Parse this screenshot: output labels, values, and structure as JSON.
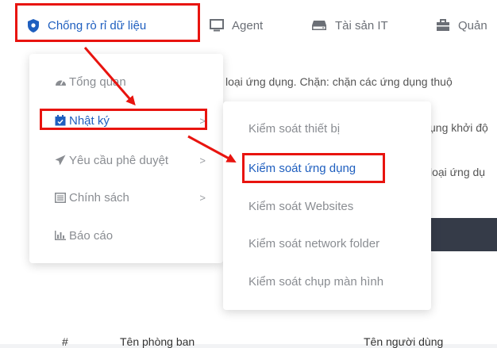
{
  "nav": {
    "items": [
      {
        "label": "Chống rò rỉ dữ liệu",
        "icon": "shield-icon"
      },
      {
        "label": "Agent",
        "icon": "monitor-icon"
      },
      {
        "label": "Tài sản IT",
        "icon": "hard-drive-icon"
      },
      {
        "label": "Quản",
        "icon": "briefcase-icon"
      }
    ]
  },
  "background": {
    "line1": "loại ứng dụng. Chặn: chặn các ứng dụng thuộ",
    "line2": "ụng khởi độ",
    "line3": "loại ứng dụ",
    "table_headers": [
      "#",
      "Tên phòng ban",
      "Tên người dùng"
    ]
  },
  "menu": {
    "items": [
      {
        "label": "Tổng quan",
        "icon": "dashboard-icon",
        "chevron": ""
      },
      {
        "label": "Nhật ký",
        "icon": "calendar-icon",
        "chevron": ">"
      },
      {
        "label": "Yêu cầu phê duyệt",
        "icon": "send-icon",
        "chevron": ">"
      },
      {
        "label": "Chính sách",
        "icon": "list-icon",
        "chevron": ">"
      },
      {
        "label": "Báo cáo",
        "icon": "bar-chart-icon",
        "chevron": ""
      }
    ]
  },
  "submenu": {
    "items": [
      {
        "label": "Kiểm soát thiết bị"
      },
      {
        "label": "Kiểm soát ứng dụng"
      },
      {
        "label": "Kiểm soát Websites"
      },
      {
        "label": "Kiểm soát network folder"
      },
      {
        "label": "Kiểm soát chụp màn hình"
      }
    ]
  },
  "colors": {
    "accent": "#1f5fbf",
    "highlight": "#e8140f",
    "muted_text": "#8a8d92"
  }
}
